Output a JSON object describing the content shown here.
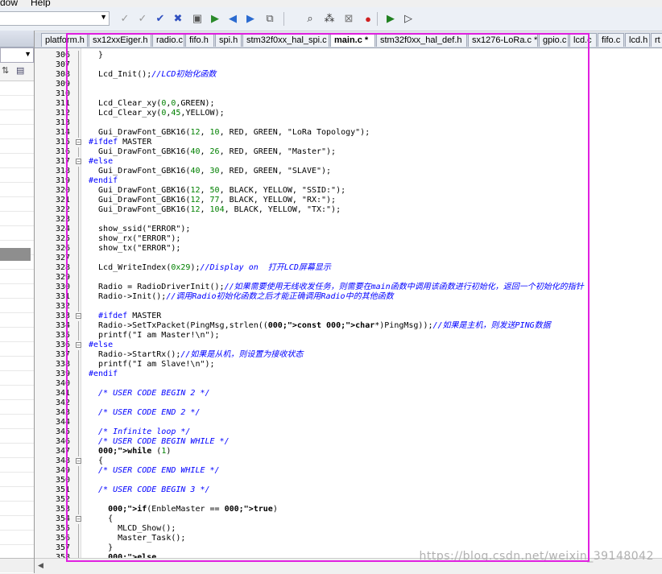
{
  "menu": {
    "items": [
      "dow",
      "Help"
    ]
  },
  "toolbar": {
    "icons": [
      "checkmark-gray-icon",
      "checkmark-gray2-icon",
      "set-breakpoint-icon",
      "clear-breakpoint-icon",
      "document-icon",
      "bookmark-icon",
      "bookmark-prev-icon",
      "bookmark-next-icon",
      "bookmark-clear-icon",
      "find-icon",
      "find-in-files-icon",
      "incremental-find-icon",
      "debug-stop-icon",
      "build-icon",
      "rebuild-icon"
    ]
  },
  "tabs": [
    {
      "label": "platform.h",
      "active": false
    },
    {
      "label": "sx12xxEiger.h",
      "active": false
    },
    {
      "label": "radio.c",
      "active": false
    },
    {
      "label": "fifo.h",
      "active": false
    },
    {
      "label": "spi.h",
      "active": false
    },
    {
      "label": "stm32f0xx_hal_spi.c",
      "active": false
    },
    {
      "label": "main.c *",
      "active": true
    },
    {
      "label": "stm32f0xx_hal_def.h",
      "active": false
    },
    {
      "label": "sx1276-LoRa.c *",
      "active": false
    },
    {
      "label": "gpio.c",
      "active": false
    },
    {
      "label": "lcd.c",
      "active": false
    },
    {
      "label": "fifo.c",
      "active": false
    },
    {
      "label": "lcd.h",
      "active": false
    },
    {
      "label": "rt",
      "active": false
    }
  ],
  "code": [
    {
      "n": "306",
      "fold": "line",
      "t": "  }"
    },
    {
      "n": "307",
      "fold": "",
      "t": ""
    },
    {
      "n": "308",
      "fold": "",
      "t": "  Lcd_Init();//LCD初始化函数"
    },
    {
      "n": "309",
      "fold": "",
      "t": ""
    },
    {
      "n": "310",
      "fold": "",
      "t": ""
    },
    {
      "n": "311",
      "fold": "",
      "t": "  Lcd_Clear_xy(0,0,GREEN);"
    },
    {
      "n": "312",
      "fold": "",
      "t": "  Lcd_Clear_xy(0,45,YELLOW);"
    },
    {
      "n": "313",
      "fold": "",
      "t": ""
    },
    {
      "n": "314",
      "fold": "",
      "t": "  Gui_DrawFont_GBK16(12, 10, RED, GREEN, \"LoRa Topology\");"
    },
    {
      "n": "315",
      "fold": "box",
      "t": "#ifdef MASTER"
    },
    {
      "n": "316",
      "fold": "",
      "t": "  Gui_DrawFont_GBK16(40, 26, RED, GREEN, \"Master\");"
    },
    {
      "n": "317",
      "fold": "box",
      "t": "#else"
    },
    {
      "n": "318",
      "fold": "",
      "t": "  Gui_DrawFont_GBK16(40, 30, RED, GREEN, \"SLAVE\");"
    },
    {
      "n": "319",
      "fold": "",
      "t": "#endif"
    },
    {
      "n": "320",
      "fold": "",
      "t": "  Gui_DrawFont_GBK16(12, 50, BLACK, YELLOW, \"SSID:\");"
    },
    {
      "n": "321",
      "fold": "",
      "t": "  Gui_DrawFont_GBK16(12, 77, BLACK, YELLOW, \"RX:\");"
    },
    {
      "n": "322",
      "fold": "",
      "t": "  Gui_DrawFont_GBK16(12, 104, BLACK, YELLOW, \"TX:\");"
    },
    {
      "n": "323",
      "fold": "",
      "t": ""
    },
    {
      "n": "324",
      "fold": "",
      "t": "  show_ssid(\"ERROR\");"
    },
    {
      "n": "325",
      "fold": "",
      "t": "  show_rx(\"ERROR\");"
    },
    {
      "n": "326",
      "fold": "",
      "t": "  show_tx(\"ERROR\");"
    },
    {
      "n": "327",
      "fold": "",
      "t": ""
    },
    {
      "n": "328",
      "fold": "",
      "t": "  Lcd_WriteIndex(0x29);//Display on  打开LCD屏幕显示"
    },
    {
      "n": "329",
      "fold": "",
      "t": ""
    },
    {
      "n": "330",
      "fold": "",
      "t": "  Radio = RadioDriverInit();//如果需要使用无线收发任务，则需要在main函数中调用该函数进行初始化，返回一个初始化的指针"
    },
    {
      "n": "331",
      "fold": "",
      "t": "  Radio->Init();//调用Radio初始化函数之后才能正确调用Radio中的其他函数"
    },
    {
      "n": "332",
      "fold": "",
      "t": ""
    },
    {
      "n": "333",
      "fold": "box",
      "t": "  #ifdef MASTER"
    },
    {
      "n": "334",
      "fold": "",
      "t": "  Radio->SetTxPacket(PingMsg,strlen((const char*)PingMsg));//如果是主机，则发送PING数据"
    },
    {
      "n": "335",
      "fold": "",
      "t": "  printf(\"I am Master!\\n\");"
    },
    {
      "n": "336",
      "fold": "box",
      "t": "#else"
    },
    {
      "n": "337",
      "fold": "",
      "t": "  Radio->StartRx();//如果是从机，则设置为接收状态"
    },
    {
      "n": "338",
      "fold": "",
      "t": "  printf(\"I am Slave!\\n\");"
    },
    {
      "n": "339",
      "fold": "",
      "t": "#endif"
    },
    {
      "n": "340",
      "fold": "",
      "t": ""
    },
    {
      "n": "341",
      "fold": "",
      "t": "  /* USER CODE BEGIN 2 */"
    },
    {
      "n": "342",
      "fold": "",
      "t": ""
    },
    {
      "n": "343",
      "fold": "",
      "t": "  /* USER CODE END 2 */"
    },
    {
      "n": "344",
      "fold": "",
      "t": ""
    },
    {
      "n": "345",
      "fold": "",
      "t": "  /* Infinite loop */"
    },
    {
      "n": "346",
      "fold": "",
      "t": "  /* USER CODE BEGIN WHILE */"
    },
    {
      "n": "347",
      "fold": "",
      "t": "  while (1)"
    },
    {
      "n": "348",
      "fold": "box",
      "t": "  {"
    },
    {
      "n": "349",
      "fold": "",
      "t": "  /* USER CODE END WHILE */"
    },
    {
      "n": "350",
      "fold": "",
      "t": ""
    },
    {
      "n": "351",
      "fold": "",
      "t": "  /* USER CODE BEGIN 3 */"
    },
    {
      "n": "352",
      "fold": "",
      "t": ""
    },
    {
      "n": "353",
      "fold": "",
      "t": "    if(EnbleMaster == true)"
    },
    {
      "n": "354",
      "fold": "box",
      "t": "    {"
    },
    {
      "n": "355",
      "fold": "",
      "t": "      MLCD_Show();"
    },
    {
      "n": "356",
      "fold": "",
      "t": "      Master_Task();"
    },
    {
      "n": "357",
      "fold": "",
      "t": "    }"
    },
    {
      "n": "358",
      "fold": "",
      "t": "    else"
    }
  ],
  "watermark": "https://blog.csdn.net/weixin_39148042",
  "colors": {
    "highlight": "#e020e0",
    "comment": "#0000ff",
    "number": "#008000",
    "keyword": "#0000ff",
    "directive": "#0000ff",
    "string": "#000000"
  }
}
